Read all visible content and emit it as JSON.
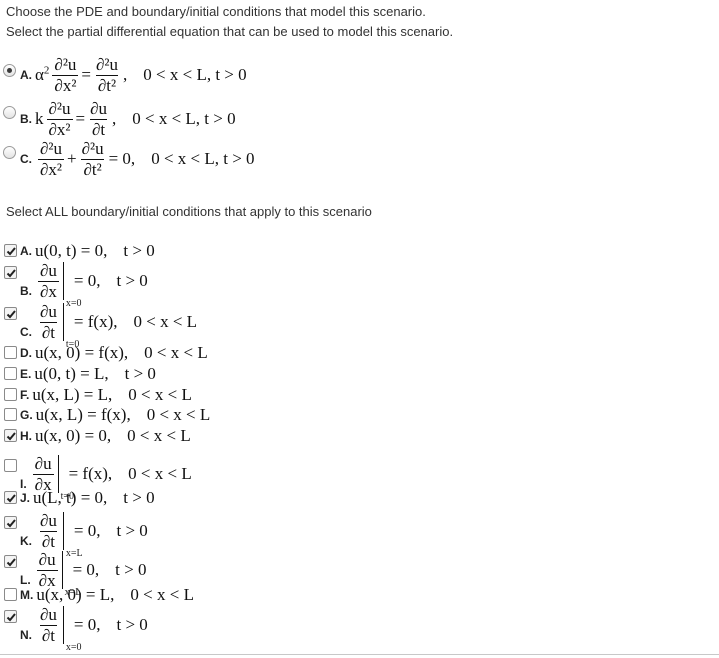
{
  "instructions": {
    "line1": "Choose the PDE and boundary/initial conditions that model this scenario.",
    "line2": "Select the partial differential equation that can be used to model this scenario."
  },
  "pde_options": [
    {
      "letter": "A.",
      "selected": true,
      "coef": "α",
      "coef_exp": "2",
      "lhs_num": "∂²u",
      "lhs_den": "∂x²",
      "op": "=",
      "rhs_num": "∂²u",
      "rhs_den": "∂t²",
      "cond": "0 < x < L, t > 0"
    },
    {
      "letter": "B.",
      "selected": false,
      "coef": "k",
      "lhs_num": "∂²u",
      "lhs_den": "∂x²",
      "op": "=",
      "rhs_num": "∂u",
      "rhs_den": "∂t",
      "cond": "0 < x < L, t > 0"
    },
    {
      "letter": "C.",
      "selected": false,
      "lhs_num": "∂²u",
      "lhs_den": "∂x²",
      "op": "+",
      "rhs_num": "∂²u",
      "rhs_den": "∂t²",
      "eq": "= 0,",
      "cond": "0 < x < L, t > 0"
    }
  ],
  "section_label": "Select ALL boundary/initial conditions that apply to this scenario",
  "conditions": [
    {
      "letter": "A.",
      "checked": true,
      "expr": "u(0, t) = 0,",
      "cond": "t > 0"
    },
    {
      "letter": "B.",
      "checked": true,
      "num": "∂u",
      "den": "∂x",
      "sub": "x=0",
      "rhs": "= 0,",
      "cond": "t > 0"
    },
    {
      "letter": "C.",
      "checked": true,
      "num": "∂u",
      "den": "∂t",
      "sub": "t=0",
      "rhs": "= f(x),",
      "cond": "0 < x < L"
    },
    {
      "letter": "D.",
      "checked": false,
      "expr": "u(x, 0) = f(x),",
      "cond": "0 < x < L"
    },
    {
      "letter": "E.",
      "checked": false,
      "expr": "u(0, t) = L,",
      "cond": "t > 0"
    },
    {
      "letter": "F.",
      "checked": false,
      "expr": "u(x, L) = L,",
      "cond": "0 < x < L"
    },
    {
      "letter": "G.",
      "checked": false,
      "expr": "u(x, L) = f(x),",
      "cond": "0 < x < L"
    },
    {
      "letter": "H.",
      "checked": true,
      "expr": "u(x, 0) = 0,",
      "cond": "0 < x < L"
    },
    {
      "letter": "I.",
      "checked": false,
      "num": "∂u",
      "den": "∂x",
      "sub": "t=0",
      "rhs": "= f(x),",
      "cond": "0 < x < L"
    },
    {
      "letter": "J.",
      "checked": true,
      "expr": "u(L, t) = 0,",
      "cond": "t > 0"
    },
    {
      "letter": "K.",
      "checked": true,
      "num": "∂u",
      "den": "∂t",
      "sub": "x=L",
      "rhs": "= 0,",
      "cond": "t > 0"
    },
    {
      "letter": "L.",
      "checked": true,
      "num": "∂u",
      "den": "∂x",
      "sub": "x=L",
      "rhs": "= 0,",
      "cond": "t > 0"
    },
    {
      "letter": "M.",
      "checked": false,
      "expr": "u(x, 0) = L,",
      "cond": "0 < x < L"
    },
    {
      "letter": "N.",
      "checked": true,
      "num": "∂u",
      "den": "∂t",
      "sub": "x=0",
      "rhs": "= 0,",
      "cond": "t > 0"
    }
  ]
}
